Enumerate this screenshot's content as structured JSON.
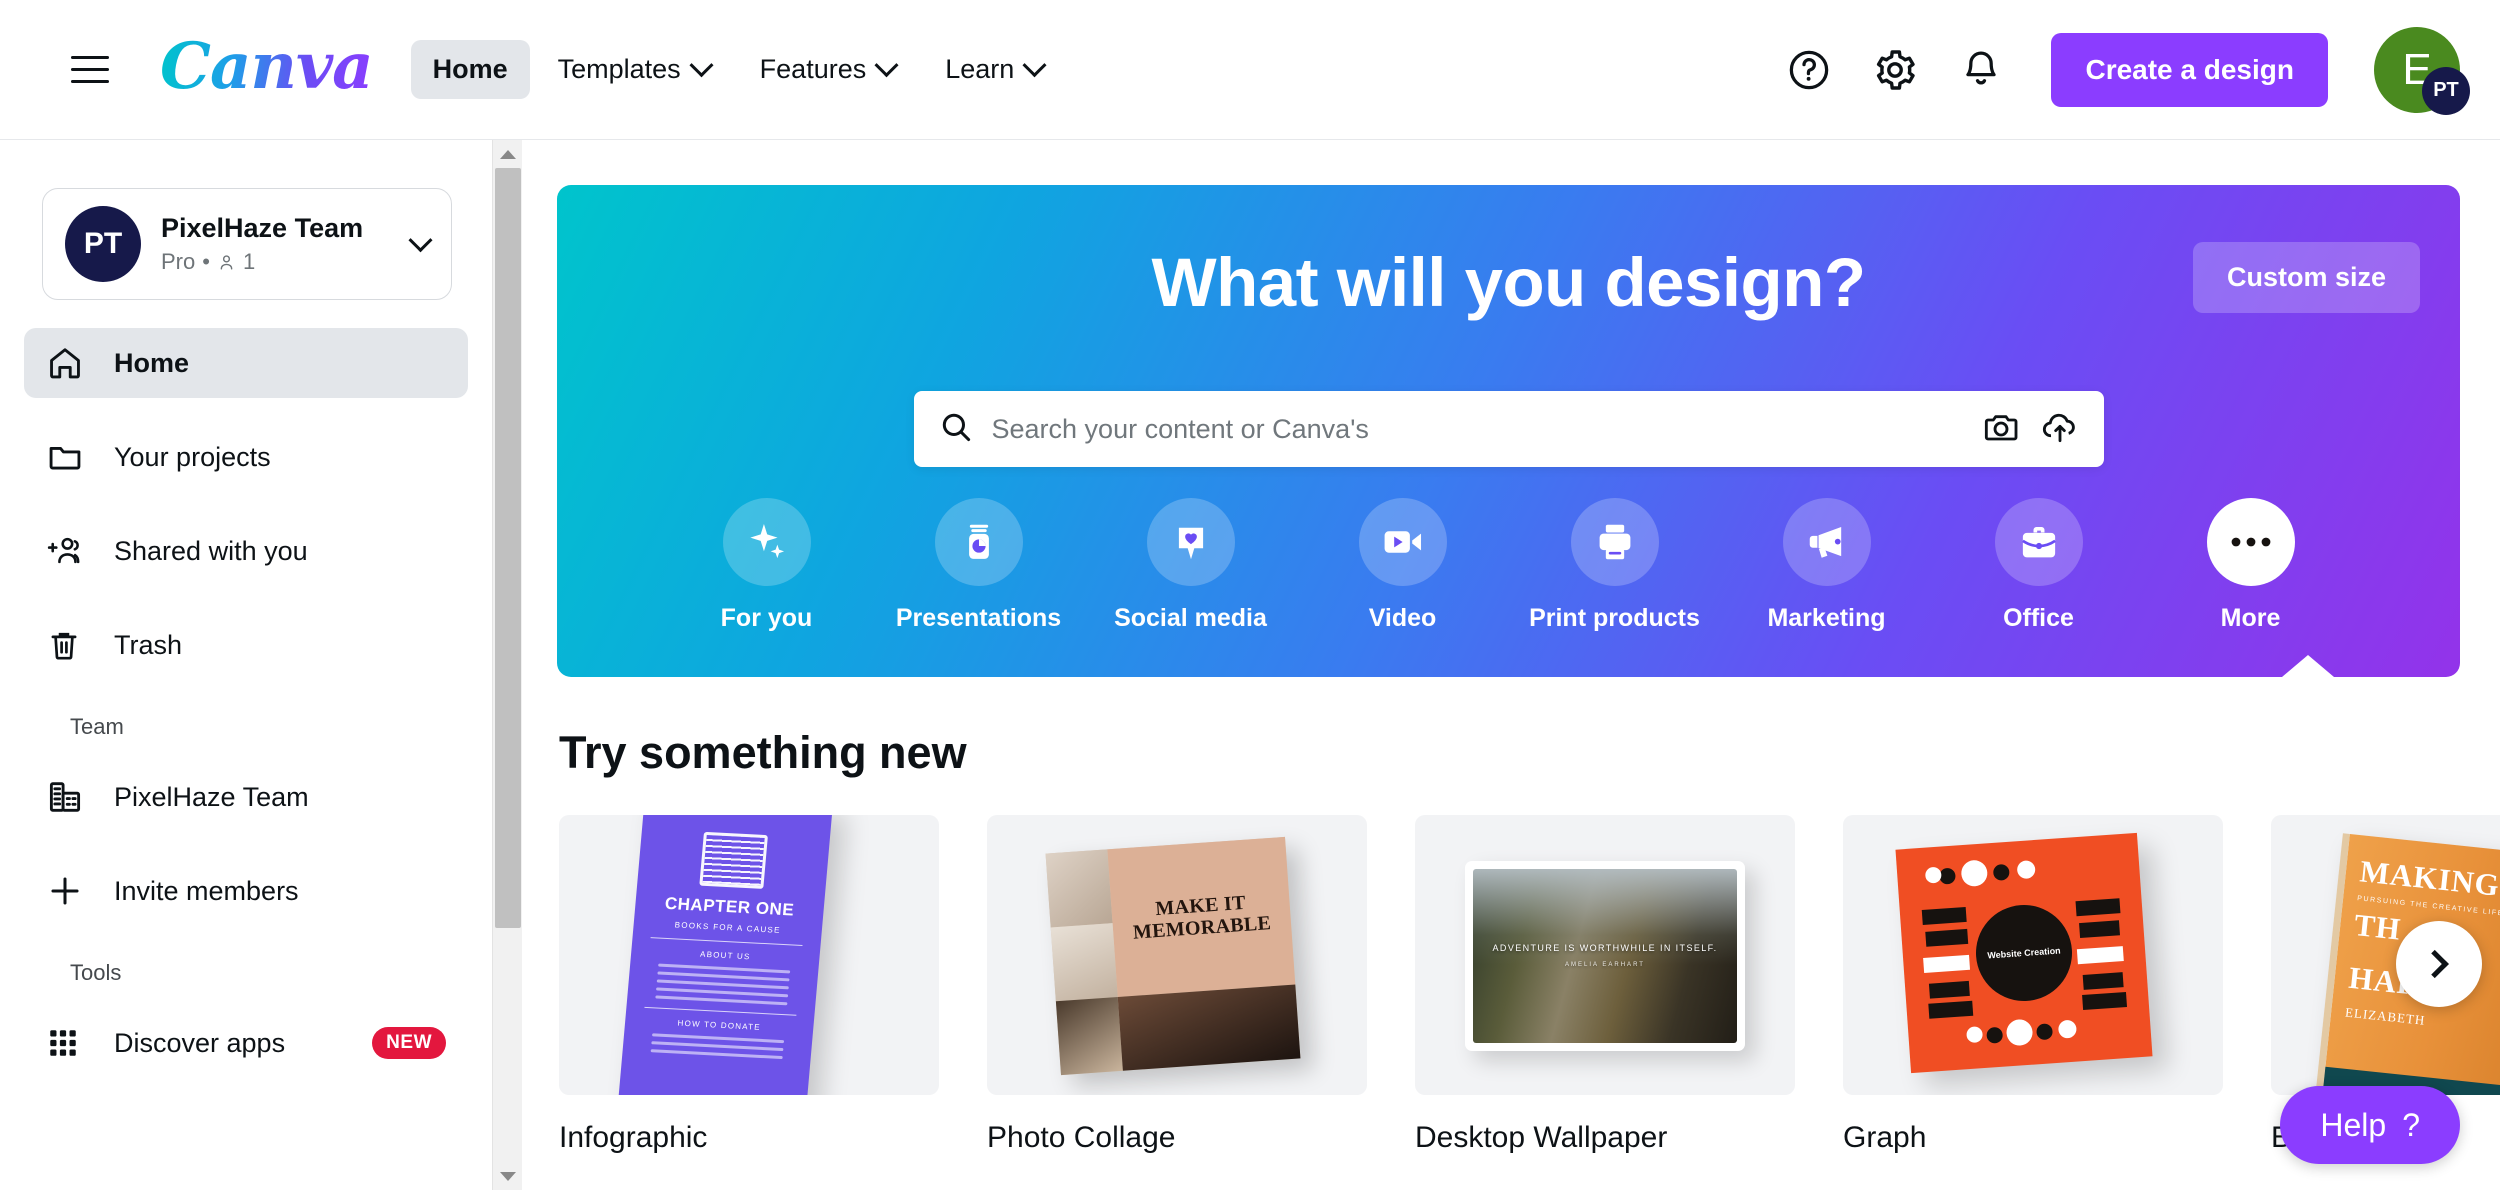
{
  "header": {
    "brand": "Canva",
    "menu_icon": "hamburger-icon",
    "nav": [
      {
        "label": "Home",
        "active": true,
        "caret": false
      },
      {
        "label": "Templates",
        "active": false,
        "caret": true
      },
      {
        "label": "Features",
        "active": false,
        "caret": true
      },
      {
        "label": "Learn",
        "active": false,
        "caret": true
      }
    ],
    "help_icon": "question-circle-icon",
    "settings_icon": "gear-icon",
    "notifications_icon": "bell-icon",
    "create_button": "Create a design",
    "avatar_initial": "E",
    "avatar_badge": "PT",
    "accent_color": "#8b3dff",
    "avatar_color": "#4a8a1f",
    "badge_color": "#16194a"
  },
  "sidebar": {
    "team": {
      "avatar_initials": "PT",
      "name": "PixelHaze Team",
      "plan": "Pro",
      "separator": "•",
      "members_count": "1",
      "chevron_icon": "chevron-down-icon"
    },
    "items": [
      {
        "label": "Home",
        "icon": "home-icon",
        "active": true
      },
      {
        "label": "Your projects",
        "icon": "folder-icon",
        "active": false
      },
      {
        "label": "Shared with you",
        "icon": "add-people-icon",
        "active": false
      },
      {
        "label": "Trash",
        "icon": "trash-icon",
        "active": false
      }
    ],
    "team_section_title": "Team",
    "team_items": [
      {
        "label": "PixelHaze Team",
        "icon": "building-icon"
      },
      {
        "label": "Invite members",
        "icon": "plus-icon"
      }
    ],
    "tools_section_title": "Tools",
    "tools_items": [
      {
        "label": "Discover apps",
        "icon": "grid-apps-icon",
        "badge": "NEW"
      }
    ],
    "badge_color": "#e3173e"
  },
  "hero": {
    "title": "What will you design?",
    "custom_size_button": "Custom size",
    "search": {
      "placeholder": "Search your content or Canva's",
      "value": "",
      "search_icon": "search-icon",
      "camera_icon": "camera-icon",
      "upload_icon": "upload-cloud-icon"
    },
    "gradient_from": "#00c4cc",
    "gradient_to": "#9333ea",
    "categories": [
      {
        "label": "For you",
        "icon": "sparkle-icon",
        "selected": false
      },
      {
        "label": "Presentations",
        "icon": "presentation-icon",
        "selected": false
      },
      {
        "label": "Social media",
        "icon": "heart-pin-icon",
        "selected": false
      },
      {
        "label": "Video",
        "icon": "video-camera-icon",
        "selected": false
      },
      {
        "label": "Print products",
        "icon": "printer-icon",
        "selected": false
      },
      {
        "label": "Marketing",
        "icon": "megaphone-icon",
        "selected": false
      },
      {
        "label": "Office",
        "icon": "briefcase-icon",
        "selected": false
      },
      {
        "label": "More",
        "icon": "ellipsis-icon",
        "selected": true
      }
    ]
  },
  "main": {
    "section_title": "Try something new",
    "cards": [
      {
        "label": "Infographic",
        "art": {
          "headline": "CHAPTER ONE",
          "subhead": "BOOKS FOR A CAUSE",
          "block1": "ABOUT US",
          "block2": "HOW TO DONATE"
        }
      },
      {
        "label": "Photo Collage",
        "art": {
          "headline": "MAKE IT MEMORABLE"
        }
      },
      {
        "label": "Desktop Wallpaper",
        "art": {
          "quote": "ADVENTURE IS WORTHWHILE IN ITSELF.",
          "author": "AMELIA EARHART"
        }
      },
      {
        "label": "Graph",
        "art": {
          "hub": "Website Creation"
        }
      },
      {
        "label": "Book Cover",
        "art": {
          "title_1": "MAKING",
          "title_2": "TH",
          "title_3": "HAPP",
          "subtitle": "PURSUING THE CREATIVE LIFE",
          "author": "ELIZABETH"
        }
      }
    ],
    "next_icon": "chevron-right-icon"
  },
  "help": {
    "label": "Help",
    "icon": "question-mark-icon",
    "color": "#8b3dff"
  }
}
